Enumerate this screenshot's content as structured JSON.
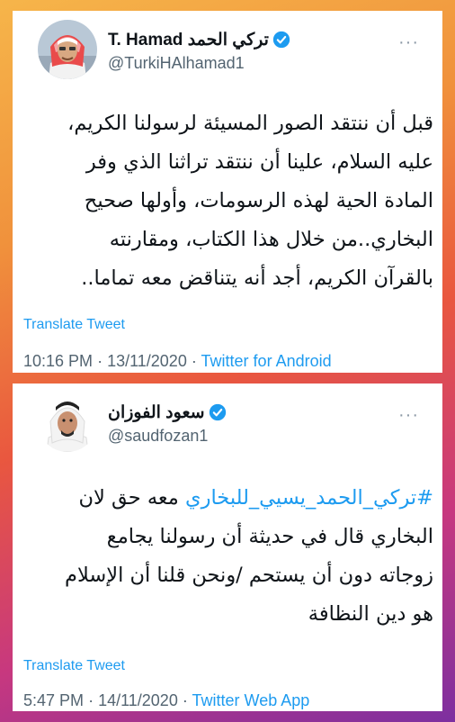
{
  "tweets": [
    {
      "display_name": "T. Hamad تركي الحمد",
      "handle": "@TurkiHAlhamad1",
      "lines": [
        "قبل أن ننتقد الصور المسيئة لرسولنا الكريم،",
        "عليه السلام، علينا أن ننتقد تراثنا الذي وفر",
        "المادة الحية لهذه الرسومات، وأولها صحيح",
        "البخاري..من خلال هذا الكتاب، ومقارنته",
        "بالقرآن الكريم، أجد أنه يتناقض معه تماما.."
      ],
      "translate_label": "Translate Tweet",
      "time": "10:16 PM",
      "date": "13/11/2020",
      "separator": "·",
      "source": "Twitter for Android"
    },
    {
      "display_name": "سعود الفوزان",
      "handle": "@saudfozan1",
      "hashtag": "#تركي_الحمد_يسيي_للبخاري",
      "line1_rest": " معه حق لان",
      "lines": [
        "البخاري قال في حديثة أن رسولنا يجامع",
        "زوجاته دون أن يستحم /ونحن قلنا أن الإسلام",
        "هو دين النظافة"
      ],
      "translate_label": "Translate Tweet",
      "time": "5:47 PM",
      "date": "14/11/2020",
      "separator": "·",
      "source": "Twitter Web App"
    }
  ],
  "more_label": "···",
  "icons": {
    "verified": "verified-badge-icon",
    "more": "more-options-icon"
  },
  "colors": {
    "link": "#1d9bf0",
    "verified": "#1d9bf0",
    "muted": "#536471",
    "text": "#0f1419"
  }
}
